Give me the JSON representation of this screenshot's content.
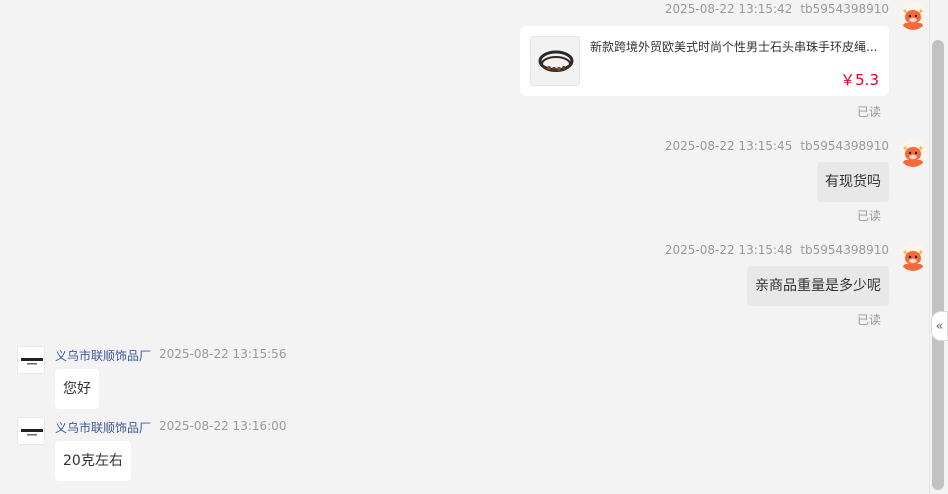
{
  "seller": {
    "name": "义乌市联顺饰品厂"
  },
  "buyer": {
    "id": "tb5954398910"
  },
  "messages": [
    {
      "time": "2025-08-22 13:15:42",
      "sender": "tb5954398910",
      "type": "product",
      "product": {
        "title": "新款跨境外贸欧美式时尚个性男士石头串珠手环皮绳...",
        "price": "￥5.3"
      },
      "status": "已读"
    },
    {
      "time": "2025-08-22 13:15:45",
      "sender": "tb5954398910",
      "text": "有现货吗",
      "status": "已读"
    },
    {
      "time": "2025-08-22 13:15:48",
      "sender": "tb5954398910",
      "text": "亲商品重量是多少呢",
      "status": "已读"
    },
    {
      "time": "2025-08-22 13:15:56",
      "sender": "义乌市联顺饰品厂",
      "text": "您好"
    },
    {
      "time": "2025-08-22 13:16:00",
      "sender": "义乌市联顺饰品厂",
      "text": "20克左右"
    }
  ],
  "ui": {
    "collapse_glyph": "«"
  },
  "colors": {
    "price": "#e4002b",
    "seller_name": "#3c5a9a",
    "meta": "#9a9a9a"
  }
}
